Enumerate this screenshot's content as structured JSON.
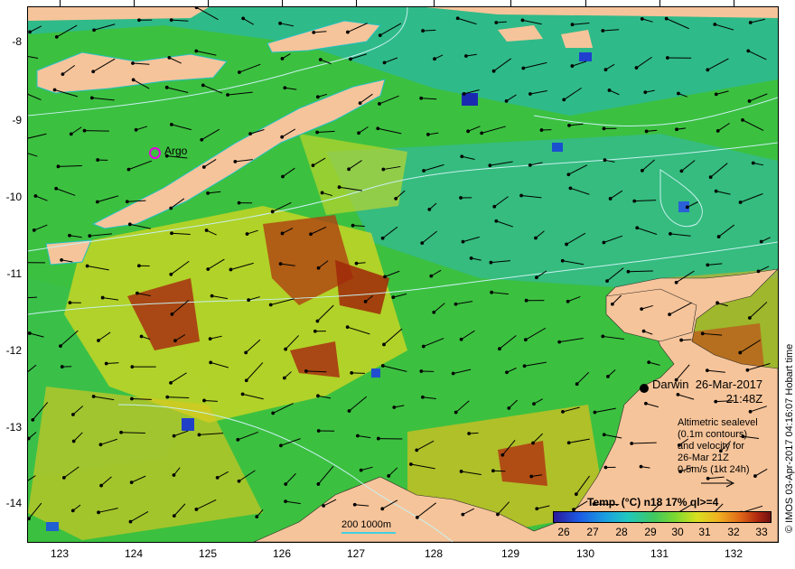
{
  "map": {
    "y_ticks": [
      "-8",
      "-9",
      "-10",
      "-11",
      "-12",
      "-13",
      "-14"
    ],
    "x_ticks": [
      "123",
      "124",
      "125",
      "126",
      "127",
      "128",
      "129",
      "130",
      "131",
      "132"
    ],
    "argo_label": "Argo",
    "darwin_label": "Darwin",
    "date": "26-Mar-2017",
    "time": "21:48Z",
    "notes": [
      "Altimetric sealevel",
      "(0.1m contours)",
      "and velocity for",
      "26-Mar 21Z",
      "0.5m/s (1kt 24h)"
    ],
    "scale_label": "200  1000m",
    "colorbar_title": "Temp. (°C) n18 17% ql>=4",
    "colorbar_ticks": [
      "26",
      "27",
      "28",
      "29",
      "30",
      "31",
      "32",
      "33"
    ],
    "credit": "© IMOS 03-Apr-2017 04:16:07 Hobart time",
    "colors": {
      "land": "#f6c49a",
      "sea_green": "#3cc040",
      "sea_cyan": "#20b8c0",
      "warm": "#e8c020",
      "hot": "#a83010",
      "contour": "#c8f0f0",
      "argo": "#e600e6"
    }
  }
}
